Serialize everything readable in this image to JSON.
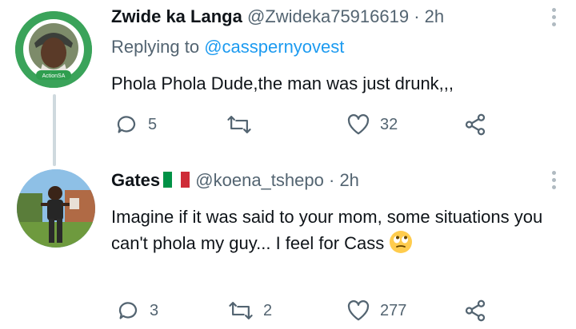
{
  "tweets": [
    {
      "author_name": "Zwide ka Langa",
      "handle": "@Zwideka75916619",
      "separator": "·",
      "time": "2h",
      "reply_prefix": "Replying to",
      "reply_to": "@casspernyovest",
      "text": "Phola Phola Dude,the man was just drunk,,,",
      "replies": "5",
      "retweets": "",
      "likes": "32",
      "avatar_badge": "ActionSA"
    },
    {
      "author_name": "Gates",
      "name_flag": "italy-flag-icon",
      "handle": "@koena_tshepo",
      "separator": "·",
      "time": "2h",
      "text": "Imagine if it was said to your mom, some situations you can't phola my guy... I feel for Cass",
      "text_emoji": "rolling-eyes-emoji-icon",
      "replies": "3",
      "retweets": "2",
      "likes": "277"
    }
  ],
  "colors": {
    "text_primary": "#0f1419",
    "text_secondary": "#536471",
    "mention": "#1d9bf0",
    "thread_line": "#cfd9de",
    "badge_green": "#2f9e4f"
  }
}
